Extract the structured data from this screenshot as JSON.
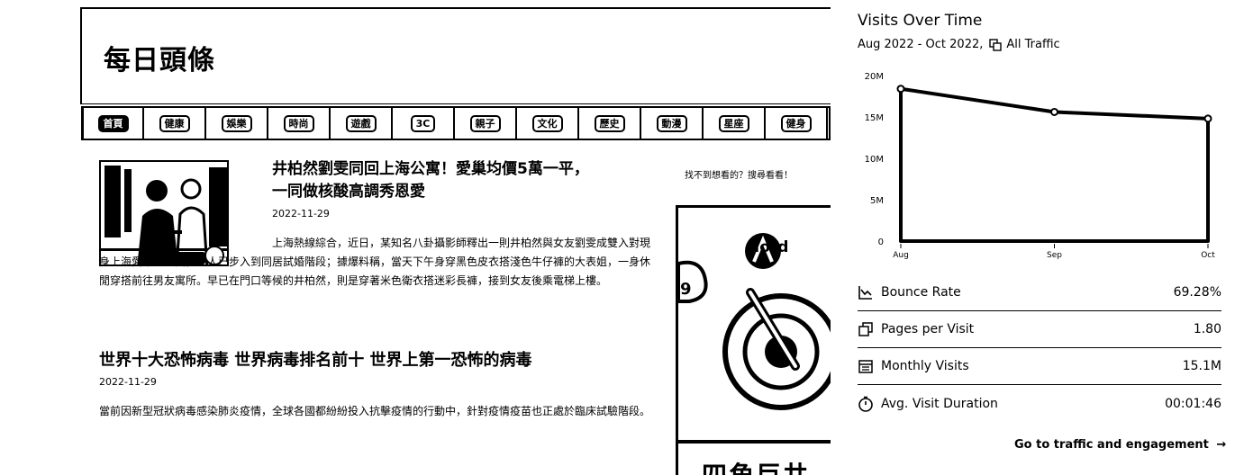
{
  "site": {
    "title": "每日頭條",
    "nav_tabs": [
      "首頁",
      "健康",
      "娛樂",
      "時尚",
      "遊戲",
      "3C",
      "親子",
      "文化",
      "歷史",
      "動漫",
      "星座",
      "健身"
    ],
    "active_tab": 0,
    "articles": [
      {
        "title_line1": "井柏然劉雯同回上海公寓！愛巢均價5萬一平，",
        "title_line2": "一同做核酸高調秀恩愛",
        "date": "2022-11-29",
        "body": "上海熱線綜合，近日，某知名八卦攝影師釋出一則井柏然與女友劉雯成雙入對現身上海愛巢的畫面，二人已步入到同居試婚階段；據爆料稱，當天下午身穿黑色皮衣搭淺色牛仔褲的大表姐，一身休閒穿搭前往男友寓所。早已在門口等候的井柏然，則是穿著米色衛衣搭迷彩長褲，接到女友後乘電梯上樓。"
      },
      {
        "title": "世界十大恐怖病毒 世界病毒排名前十 世界上第一恐怖的病毒",
        "date": "2022-11-29",
        "body": "當前因新型冠狀病毒感染肺炎疫情，全球各國都紛紛投入抗擊疫情的行動中，針對疫情疫苗也正處於臨床試驗階段。"
      }
    ],
    "side_hint": "找不到想看的？搜尋看看！",
    "ad": {
      "brand": "Nord",
      "bottom_text": "四角巨井"
    }
  },
  "panel": {
    "title": "Visits Over Time",
    "subtitle": "Aug 2022 - Oct 2022,",
    "traffic_label": "All Traffic",
    "metrics": [
      {
        "label": "Bounce Rate",
        "value": "69.28%",
        "icon": "bounce-rate-icon"
      },
      {
        "label": "Pages per Visit",
        "value": "1.80",
        "icon": "pages-icon"
      },
      {
        "label": "Monthly Visits",
        "value": "15.1M",
        "icon": "calendar-icon"
      },
      {
        "label": "Avg. Visit Duration",
        "value": "00:01:46",
        "icon": "timer-icon"
      }
    ],
    "cta": "Go to traffic and engagement",
    "cta_arrow": "→"
  },
  "chart_data": {
    "type": "line",
    "categories": [
      "Aug",
      "Sep",
      "Oct"
    ],
    "values": [
      18.4,
      15.6,
      14.8
    ],
    "yticks": [
      "0",
      "5M",
      "10M",
      "15M",
      "20M"
    ],
    "ylim": [
      0,
      20
    ],
    "title": "Visits Over Time",
    "grid": false,
    "legend": "none"
  }
}
